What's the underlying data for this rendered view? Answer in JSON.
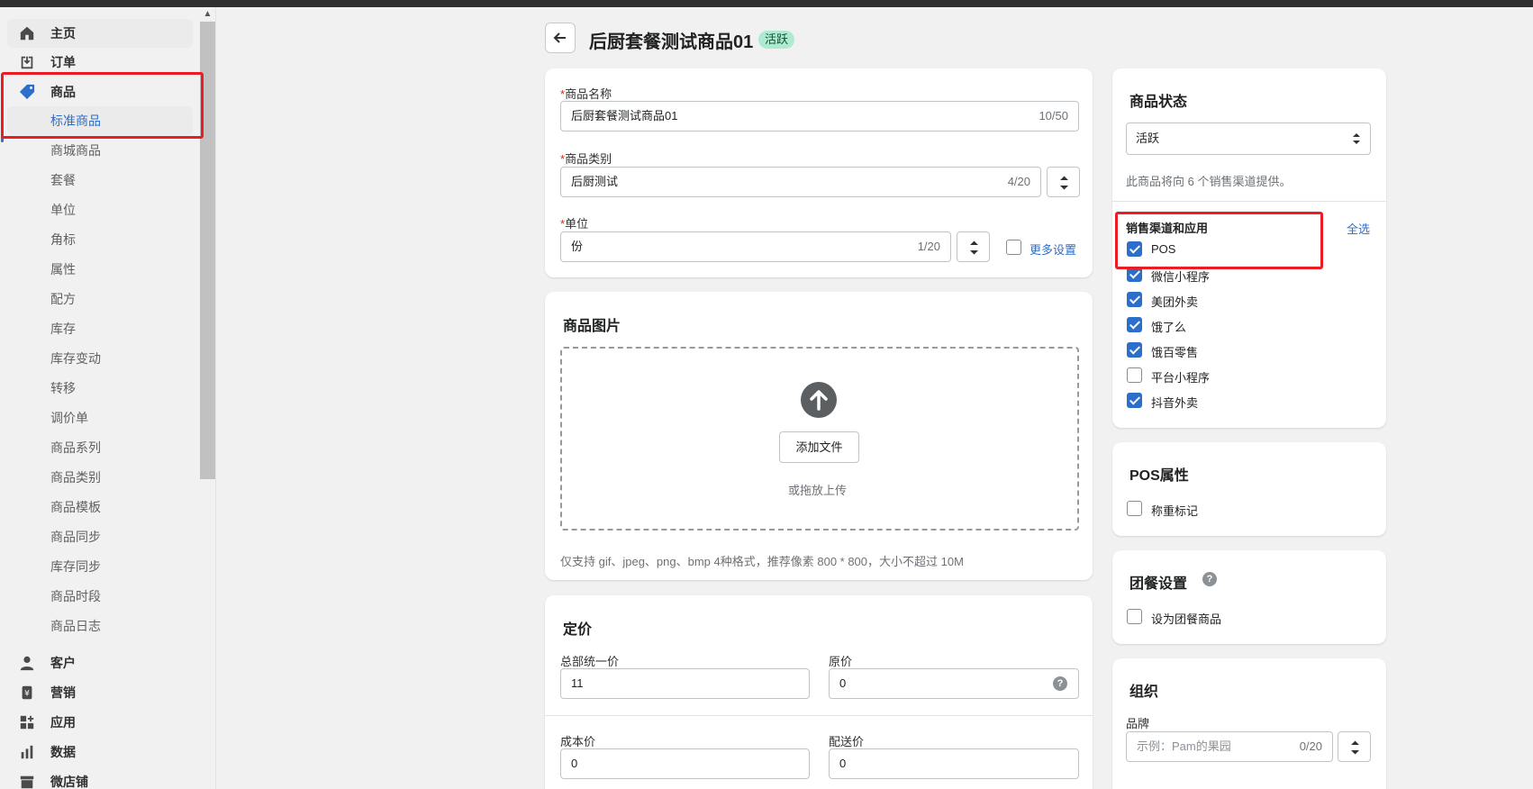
{
  "sidebar": {
    "main_items": [
      {
        "label": "主页",
        "icon": "home-icon"
      },
      {
        "label": "订单",
        "icon": "orders-icon"
      },
      {
        "label": "商品",
        "icon": "tag-icon"
      }
    ],
    "product_sub_items": [
      "标准商品",
      "商城商品",
      "套餐",
      "单位",
      "角标",
      "属性",
      "配方",
      "库存",
      "库存变动",
      "转移",
      "调价单",
      "商品系列",
      "商品类别",
      "商品模板",
      "商品同步",
      "库存同步",
      "商品时段",
      "商品日志"
    ],
    "active_sub_item": "标准商品",
    "bottom_items": [
      {
        "label": "客户",
        "icon": "customer-icon"
      },
      {
        "label": "营销",
        "icon": "marketing-icon"
      },
      {
        "label": "应用",
        "icon": "apps-icon"
      },
      {
        "label": "数据",
        "icon": "analytics-icon"
      },
      {
        "label": "微店铺",
        "icon": "store-icon"
      }
    ]
  },
  "header": {
    "title": "后厨套餐测试商品01",
    "status_badge": "活跃"
  },
  "basic_info": {
    "name_label": "商品名称",
    "name_value": "后厨套餐测试商品01",
    "name_count": "10/50",
    "category_label": "商品类别",
    "category_value": "后厨测试",
    "category_count": "4/20",
    "unit_label": "单位",
    "unit_value": "份",
    "unit_count": "1/20",
    "more_settings": "更多设置",
    "required_mark": "*"
  },
  "images": {
    "title": "商品图片",
    "add_file": "添加文件",
    "drag_hint": "或拖放上传",
    "format_hint": "仅支持 gif、jpeg、png、bmp 4种格式，推荐像素 800 * 800，大小不超过 10M"
  },
  "pricing": {
    "title": "定价",
    "hq_price_label": "总部统一价",
    "hq_price_value": "11",
    "original_price_label": "原价",
    "original_price_value": "0",
    "cost_price_label": "成本价",
    "cost_price_value": "0",
    "delivery_price_label": "配送价",
    "delivery_price_value": "0"
  },
  "status_card": {
    "title": "商品状态",
    "selected": "活跃",
    "channel_info": "此商品将向 6 个销售渠道提供。",
    "channels_title": "销售渠道和应用",
    "select_all": "全选",
    "channels": [
      {
        "label": "POS",
        "checked": true
      },
      {
        "label": "微信小程序",
        "checked": true
      },
      {
        "label": "美团外卖",
        "checked": true
      },
      {
        "label": "饿了么",
        "checked": true
      },
      {
        "label": "饿百零售",
        "checked": true
      },
      {
        "label": "平台小程序",
        "checked": false
      },
      {
        "label": "抖音外卖",
        "checked": true
      }
    ]
  },
  "pos_attrs": {
    "title": "POS属性",
    "weigh_label": "称重标记",
    "weigh_checked": false
  },
  "group_meal": {
    "title": "团餐设置",
    "set_label": "设为团餐商品",
    "set_checked": false
  },
  "organization": {
    "title": "组织",
    "brand_label": "品牌",
    "brand_placeholder": "示例：Pam的果园",
    "brand_count": "0/20"
  },
  "colors": {
    "accent": "#2c6ecb",
    "highlight": "#ea1c24",
    "badge_bg": "#aee9d1"
  }
}
